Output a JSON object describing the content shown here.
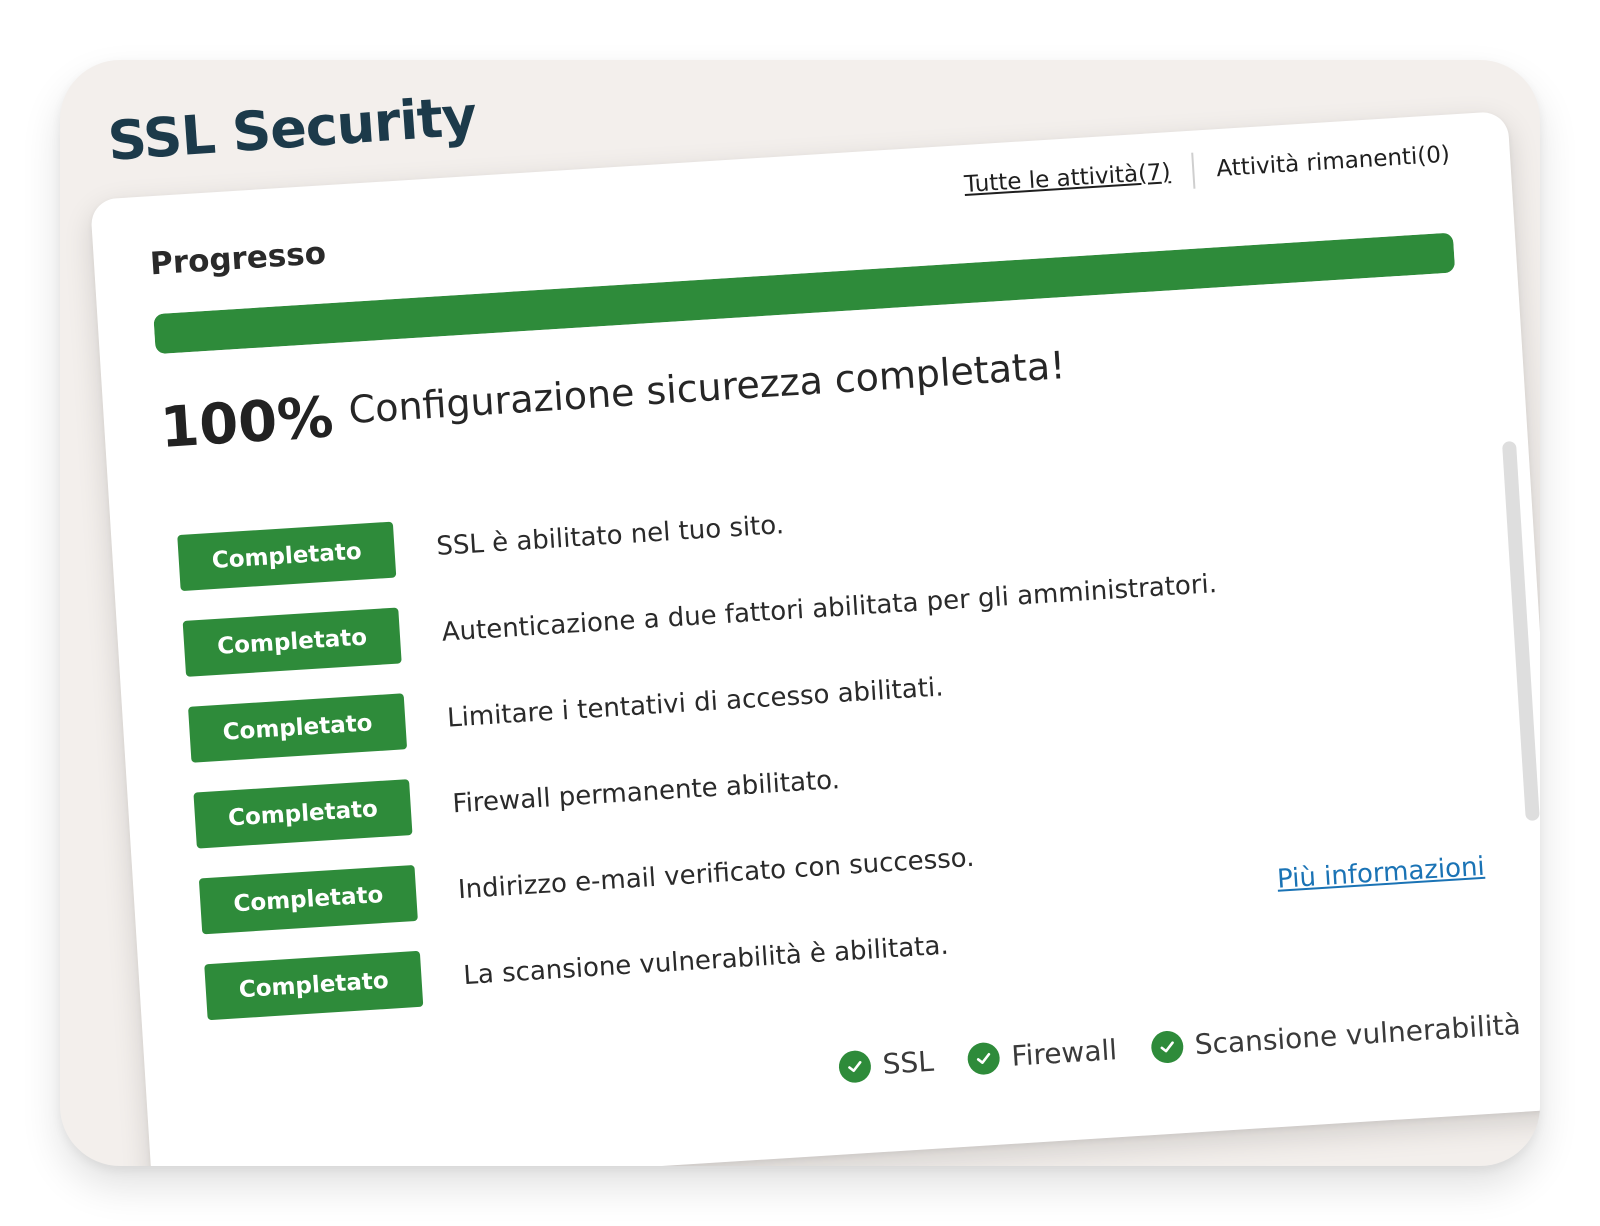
{
  "app": {
    "title": "SSL Security"
  },
  "panel": {
    "title": "Progresso",
    "links": {
      "all_tasks": "Tutte le attività(7)",
      "remaining_tasks": "Attività rimanenti(0)"
    },
    "progress": {
      "percent_value": 100,
      "percent_label": "100%",
      "message": "Configurazione sicurezza completata!"
    },
    "tasks": [
      {
        "status": "Completato",
        "text": "SSL è abilitato nel tuo sito."
      },
      {
        "status": "Completato",
        "text": "Autenticazione a due fattori abilitata per gli amministratori."
      },
      {
        "status": "Completato",
        "text": "Limitare i tentativi di accesso abilitati."
      },
      {
        "status": "Completato",
        "text": "Firewall permanente abilitato."
      },
      {
        "status": "Completato",
        "text": "Indirizzo e-mail verificato con successo."
      },
      {
        "status": "Completato",
        "text": "La scansione vulnerabilità è abilitata."
      }
    ],
    "more_info_label": "Più informazioni",
    "features": [
      {
        "label": "SSL",
        "icon": "check-circle-icon"
      },
      {
        "label": "Firewall",
        "icon": "check-circle-icon"
      },
      {
        "label": "Scansione vulnerabilità",
        "icon": "check-circle-icon"
      }
    ]
  },
  "colors": {
    "brand": "#1c3a4a",
    "success": "#2e8b3a",
    "link": "#1a73b5",
    "background": "#f3efec"
  }
}
